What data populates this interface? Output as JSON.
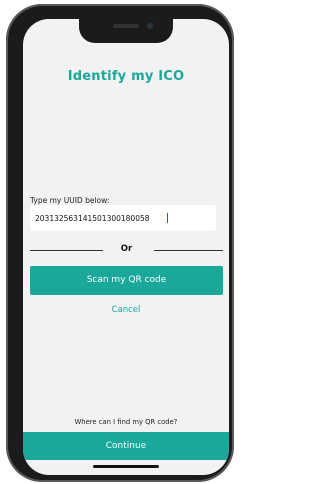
{
  "page": {
    "title": "Identify my ICO"
  },
  "uuid": {
    "label": "Type my UUID below:",
    "value": "203132563141501300180058"
  },
  "divider": {
    "text": "Or"
  },
  "actions": {
    "scan_label": "Scan my QR code",
    "cancel_label": "Cancel",
    "continue_label": "Continue"
  },
  "help": {
    "text": "Where can I find my QR code?"
  },
  "colors": {
    "accent": "#1aa89a",
    "background": "#f2f2f2"
  }
}
